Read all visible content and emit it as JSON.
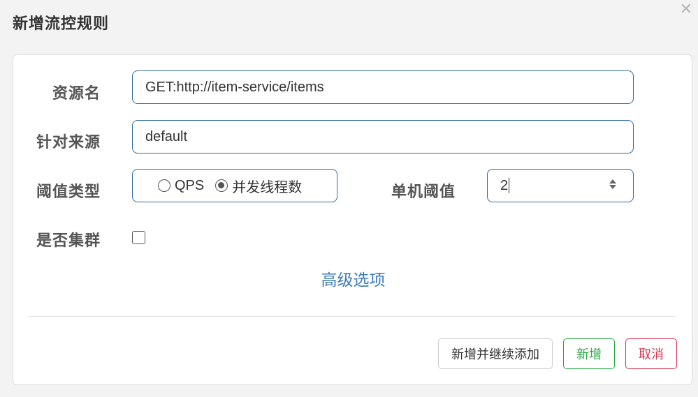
{
  "dialog": {
    "title": "新增流控规则",
    "close_glyph": "✕"
  },
  "form": {
    "resource_label": "资源名",
    "resource_value": "GET:http://item-service/items",
    "origin_label": "针对来源",
    "origin_value": "default",
    "threshold_type_label": "阈值类型",
    "threshold_type_options": [
      {
        "label": "QPS",
        "checked": false
      },
      {
        "label": "并发线程数",
        "checked": true
      }
    ],
    "single_threshold_label": "单机阈值",
    "single_threshold_value": "2",
    "cluster_label": "是否集群",
    "cluster_checked": false,
    "advanced_link": "高级选项"
  },
  "buttons": {
    "continue_label": "新增并继续添加",
    "add_label": "新增",
    "cancel_label": "取消"
  },
  "colors": {
    "input_border": "#2e6a9e",
    "link": "#3b7bb7",
    "success": "#28a745",
    "danger": "#d9334f"
  }
}
